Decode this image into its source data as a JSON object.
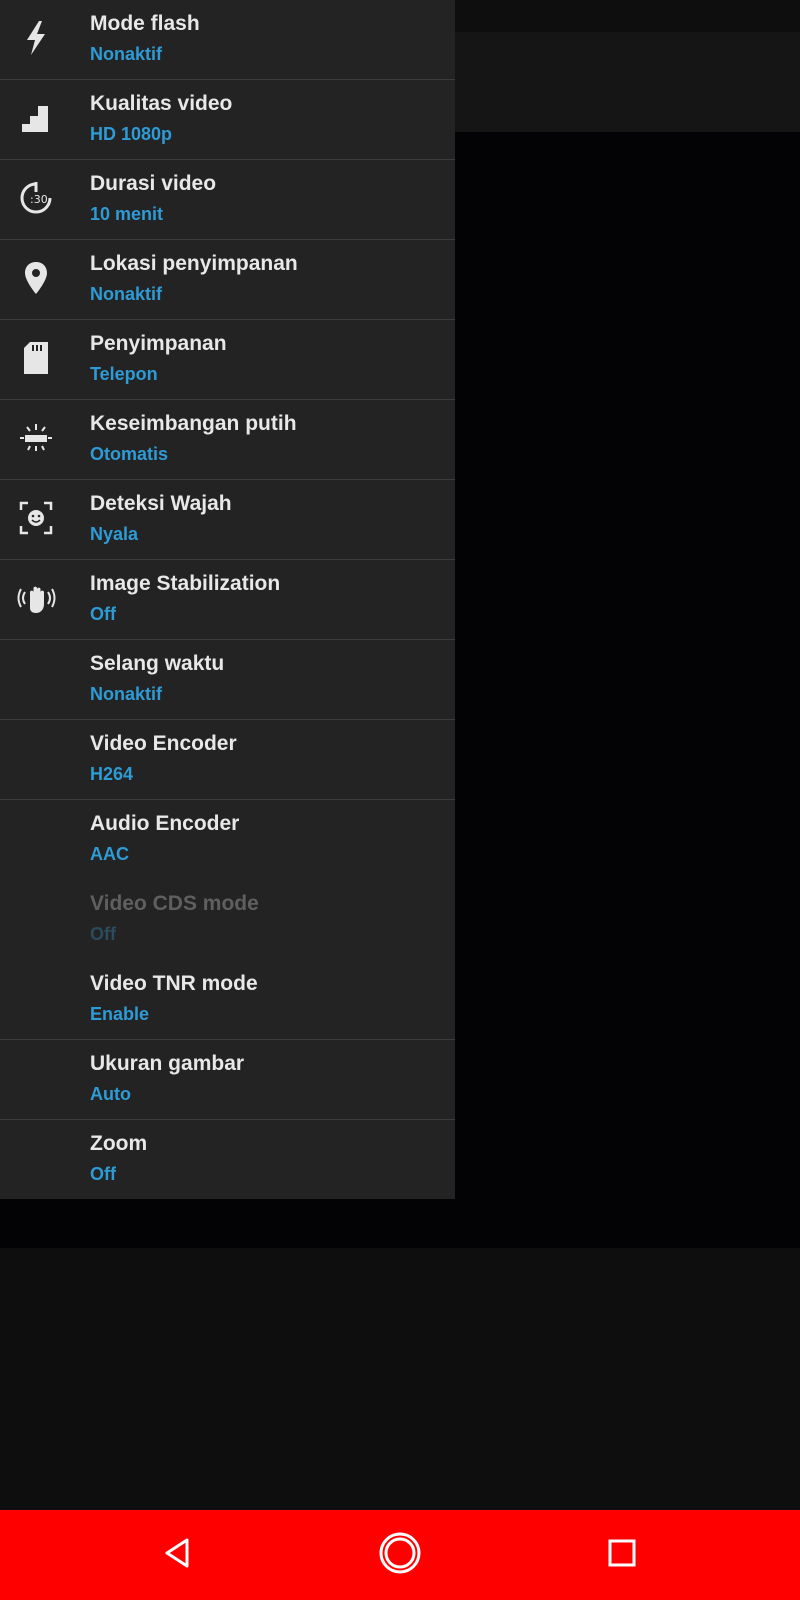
{
  "settings": {
    "items": [
      {
        "title": "Mode flash",
        "value": "Nonaktif",
        "icon": "flash-icon"
      },
      {
        "title": "Kualitas video",
        "value": "HD 1080p",
        "icon": "video-quality-icon"
      },
      {
        "title": "Durasi video",
        "value": "10 menit",
        "icon": "timer-icon"
      },
      {
        "title": "Lokasi penyimpanan",
        "value": "Nonaktif",
        "icon": "location-pin-icon"
      },
      {
        "title": "Penyimpanan",
        "value": "Telepon",
        "icon": "sd-card-icon"
      },
      {
        "title": "Keseimbangan putih",
        "value": "Otomatis",
        "icon": "white-balance-icon"
      },
      {
        "title": "Deteksi Wajah",
        "value": "Nyala",
        "icon": "face-detect-icon"
      },
      {
        "title": "Image Stabilization",
        "value": "Off",
        "icon": "stabilization-hand-icon"
      },
      {
        "title": "Selang waktu",
        "value": "Nonaktif"
      },
      {
        "title": "Video Encoder",
        "value": "H264"
      },
      {
        "title": "Audio Encoder",
        "value": "AAC"
      },
      {
        "title": "Video CDS mode",
        "value": "Off",
        "disabled": true
      },
      {
        "title": "Video TNR mode",
        "value": "Enable"
      },
      {
        "title": "Ukuran gambar",
        "value": "Auto"
      },
      {
        "title": "Zoom",
        "value": "Off"
      }
    ]
  },
  "colors": {
    "panel": "#232323",
    "title": "#e8e8e8",
    "value_accent": "#2e9bd6",
    "navbar": "#ff0000"
  },
  "navbar": {
    "back_icon": "back-triangle-icon",
    "home_icon": "home-circle-icon",
    "recent_icon": "recent-square-icon"
  }
}
